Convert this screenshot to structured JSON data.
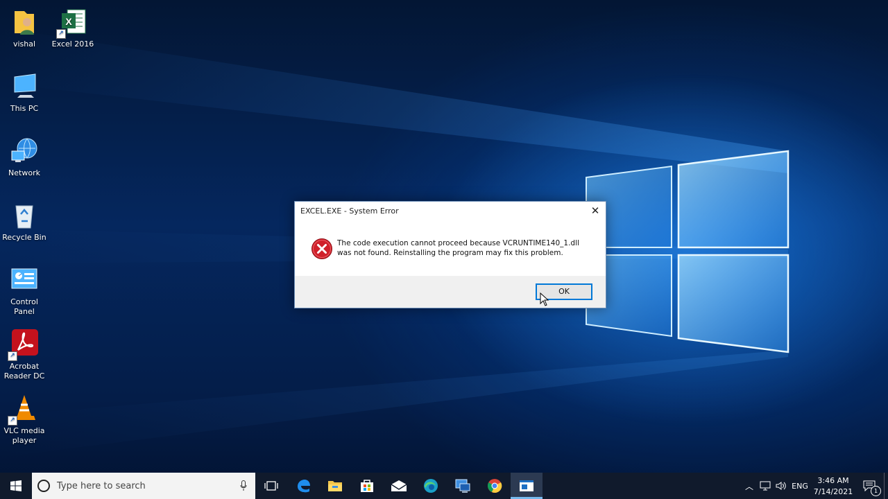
{
  "desktop": {
    "icons": [
      {
        "label": "vishal",
        "icon": "user-folder-icon"
      },
      {
        "label": "Excel 2016",
        "icon": "excel-icon"
      },
      {
        "label": "This PC",
        "icon": "computer-icon"
      },
      {
        "label": "Network",
        "icon": "network-icon"
      },
      {
        "label": "Recycle Bin",
        "icon": "recycle-bin-icon"
      },
      {
        "label": "Control Panel",
        "icon": "control-panel-icon"
      },
      {
        "label": "Acrobat Reader DC",
        "icon": "acrobat-icon"
      },
      {
        "label": "VLC media player",
        "icon": "vlc-icon"
      }
    ]
  },
  "dialog": {
    "title": "EXCEL.EXE - System Error",
    "message": "The code execution cannot proceed because VCRUNTIME140_1.dll was not found. Reinstalling the program may fix this problem.",
    "ok_label": "OK",
    "icon": "error-icon"
  },
  "taskbar": {
    "search_placeholder": "Type here to search",
    "apps": [
      "task-view-icon",
      "edge-legacy-icon",
      "file-explorer-icon",
      "store-icon",
      "mail-icon",
      "edge-icon",
      "remote-desktop-icon",
      "chrome-icon",
      "active-app-icon"
    ],
    "tray": {
      "language": "ENG",
      "time": "3:46 AM",
      "date": "7/14/2021",
      "notification_count": "1"
    }
  },
  "colors": {
    "accent": "#0078d7",
    "taskbar": "#101a2c",
    "error_red": "#d0202a"
  }
}
